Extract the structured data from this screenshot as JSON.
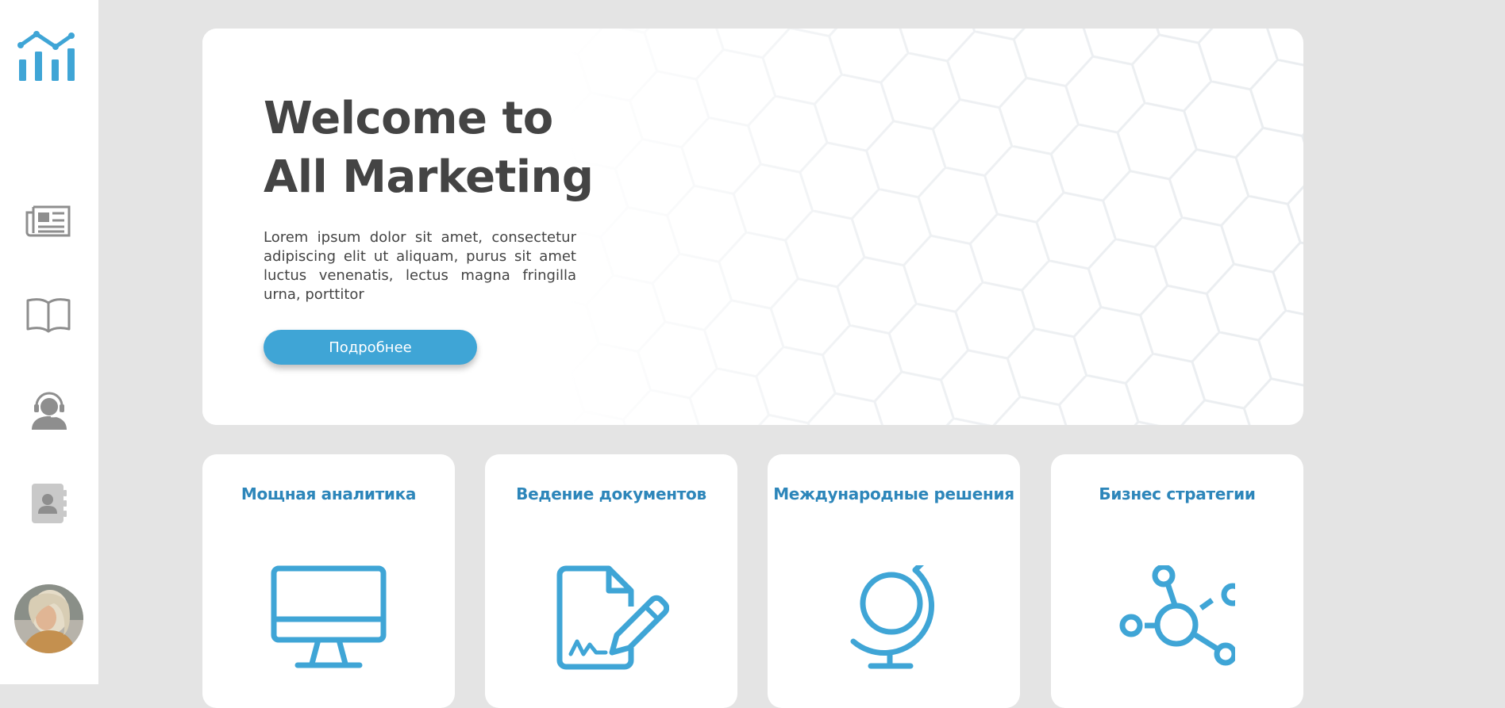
{
  "hero": {
    "title_line1": "Welcome to",
    "title_line2": "All Marketing",
    "description": "Lorem ipsum dolor sit amet, consectetur adipiscing elit ut aliquam, purus sit amet luctus venenatis, lectus magna fringilla urna, porttitor",
    "button_label": "Подробнее"
  },
  "sidebar": {
    "logo": "bar-chart-logo-icon",
    "items": [
      {
        "icon": "newspaper-icon"
      },
      {
        "icon": "book-icon"
      },
      {
        "icon": "support-headset-icon"
      },
      {
        "icon": "contacts-book-icon"
      }
    ],
    "avatar": "user-avatar"
  },
  "features": [
    {
      "title": "Мощная аналитика",
      "icon": "monitor-icon"
    },
    {
      "title": "Ведение документов",
      "icon": "document-sign-icon"
    },
    {
      "title": "Международные решения",
      "icon": "globe-icon"
    },
    {
      "title": "Бизнес стратегии",
      "icon": "network-nodes-icon"
    }
  ],
  "colors": {
    "accent": "#3fa5d6",
    "card_title": "#2d86ba",
    "heading": "#444444",
    "sidebar_icon": "#8e8e8e",
    "background": "#e4e4e4"
  }
}
